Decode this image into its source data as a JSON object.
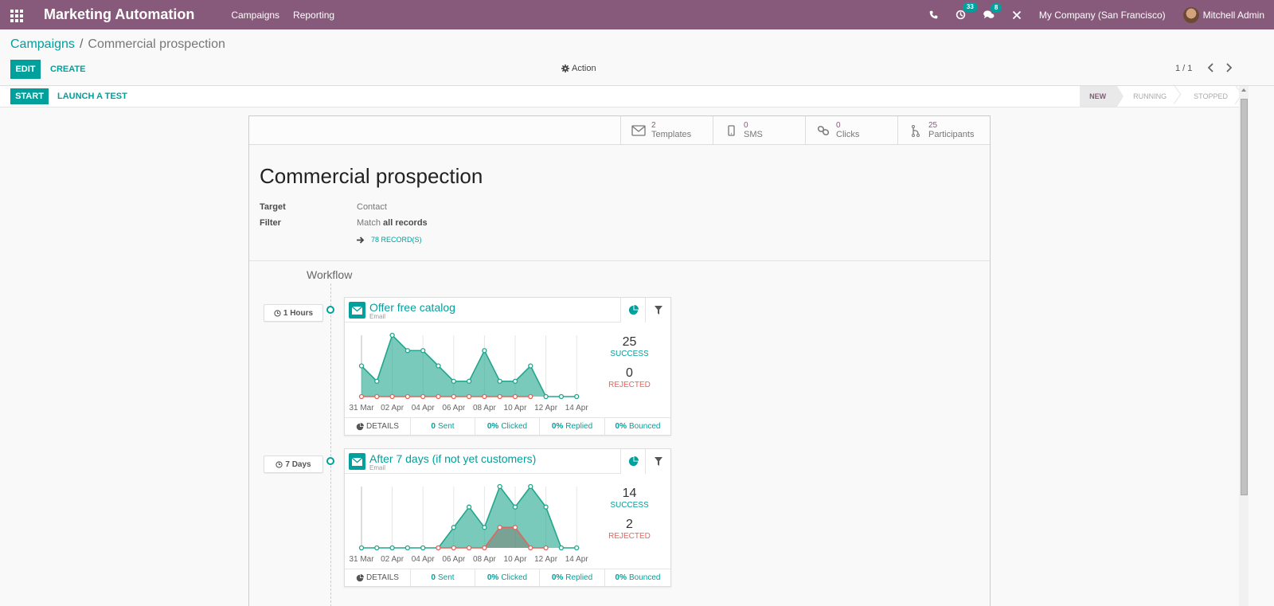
{
  "navbar": {
    "app_title": "Marketing Automation",
    "menu": [
      "Campaigns",
      "Reporting"
    ],
    "activity_count": "33",
    "messages_count": "8",
    "company": "My Company (San Francisco)",
    "user": "Mitchell Admin",
    "brand_color": "#875a7b"
  },
  "breadcrumb": {
    "parent": "Campaigns",
    "separator": "/",
    "current": "Commercial prospection"
  },
  "control_panel": {
    "edit_label": "EDIT",
    "create_label": "CREATE",
    "action_label": "Action",
    "pager": "1 / 1"
  },
  "statusbar": {
    "start_label": "START",
    "test_label": "LAUNCH A TEST",
    "stages": [
      "NEW",
      "RUNNING",
      "STOPPED"
    ],
    "active_stage": "NEW"
  },
  "stat_buttons": [
    {
      "icon": "envelope-icon",
      "value": "2",
      "label": "Templates"
    },
    {
      "icon": "mobile-icon",
      "value": "0",
      "label": "SMS"
    },
    {
      "icon": "link-icon",
      "value": "0",
      "label": "Clicks"
    },
    {
      "icon": "fork-icon",
      "value": "25",
      "label": "Participants"
    }
  ],
  "form": {
    "title": "Commercial prospection",
    "target_label": "Target",
    "target_value": "Contact",
    "filter_label": "Filter",
    "filter_prefix": "Match",
    "filter_value": "all records",
    "records_link": "78 RECORD(S)"
  },
  "workflow": {
    "title": "Workflow",
    "activities": [
      {
        "interval": "1 Hours",
        "name": "Offer free catalog",
        "type": "Email",
        "success_count": "25",
        "success_label": "SUCCESS",
        "rejected_count": "0",
        "rejected_label": "REJECTED",
        "details_label": "DETAILS",
        "sent": "0",
        "sent_label": "Sent",
        "clicked": "0%",
        "clicked_label": "Clicked",
        "replied": "0%",
        "replied_label": "Replied",
        "bounced": "0%",
        "bounced_label": "Bounced"
      },
      {
        "interval": "7 Days",
        "name": "After 7 days (if not yet customers)",
        "type": "Email",
        "success_count": "14",
        "success_label": "SUCCESS",
        "rejected_count": "2",
        "rejected_label": "REJECTED",
        "details_label": "DETAILS",
        "sent": "0",
        "sent_label": "Sent",
        "clicked": "0%",
        "clicked_label": "Clicked",
        "replied": "0%",
        "replied_label": "Replied",
        "bounced": "0%",
        "bounced_label": "Bounced"
      }
    ]
  },
  "chart_data": [
    {
      "type": "area",
      "title": "Offer free catalog",
      "x": [
        "31 Mar",
        "01 Apr",
        "02 Apr",
        "03 Apr",
        "04 Apr",
        "05 Apr",
        "06 Apr",
        "07 Apr",
        "08 Apr",
        "09 Apr",
        "10 Apr",
        "11 Apr",
        "12 Apr",
        "13 Apr",
        "14 Apr"
      ],
      "tick_labels": [
        "31 Mar",
        "02 Apr",
        "04 Apr",
        "06 Apr",
        "08 Apr",
        "10 Apr",
        "12 Apr",
        "14 Apr"
      ],
      "series": [
        {
          "name": "Success",
          "color": "#21a68d",
          "values": [
            2,
            1,
            4,
            3,
            3,
            2,
            1,
            1,
            3,
            1,
            1,
            2,
            0,
            0,
            0
          ]
        },
        {
          "name": "Rejected",
          "color": "#e0655d",
          "values": [
            0,
            0,
            0,
            0,
            0,
            0,
            0,
            0,
            0,
            0,
            0,
            0,
            null,
            null,
            null
          ]
        }
      ],
      "ylim": [
        0,
        4
      ],
      "grid": true
    },
    {
      "type": "area",
      "title": "After 7 days (if not yet customers)",
      "x": [
        "31 Mar",
        "01 Apr",
        "02 Apr",
        "03 Apr",
        "04 Apr",
        "05 Apr",
        "06 Apr",
        "07 Apr",
        "08 Apr",
        "09 Apr",
        "10 Apr",
        "11 Apr",
        "12 Apr",
        "13 Apr",
        "14 Apr"
      ],
      "tick_labels": [
        "31 Mar",
        "02 Apr",
        "04 Apr",
        "06 Apr",
        "08 Apr",
        "10 Apr",
        "12 Apr",
        "14 Apr"
      ],
      "series": [
        {
          "name": "Success",
          "color": "#21a68d",
          "values": [
            0,
            0,
            0,
            0,
            0,
            0,
            1,
            2,
            1,
            3,
            2,
            3,
            2,
            0,
            0
          ]
        },
        {
          "name": "Rejected",
          "color": "#e0655d",
          "values": [
            null,
            null,
            null,
            null,
            null,
            0,
            0,
            0,
            0,
            1,
            1,
            0,
            0,
            null,
            null
          ]
        }
      ],
      "ylim": [
        0,
        3
      ],
      "grid": true
    }
  ]
}
